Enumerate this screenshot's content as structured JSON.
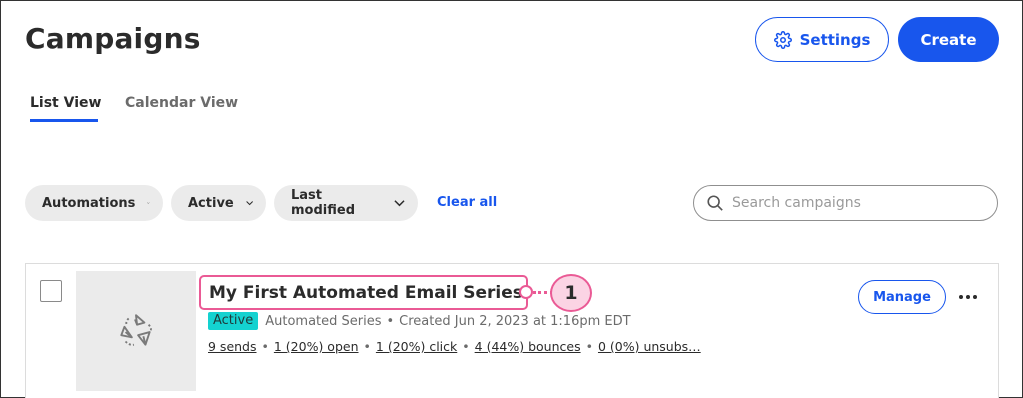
{
  "header": {
    "title": "Campaigns",
    "settings_label": "Settings",
    "create_label": "Create"
  },
  "tabs": [
    {
      "label": "List View",
      "active": true
    },
    {
      "label": "Calendar View",
      "active": false
    }
  ],
  "filters": {
    "items": [
      {
        "label": "Automations"
      },
      {
        "label": "Active"
      },
      {
        "label": "Last modified"
      }
    ],
    "clear_all_label": "Clear all"
  },
  "search": {
    "placeholder": "Search campaigns",
    "value": ""
  },
  "campaign": {
    "title": "My First Automated Email Series",
    "status": "Active",
    "type": "Automated Series",
    "meta_sep": "•",
    "created": "Created Jun 2, 2023 at 1:16pm EDT",
    "stats": [
      "9 sends",
      "1 (20%) open",
      "1 (20%) click",
      "4 (44%) bounces",
      "0 (0%) unsubs…"
    ],
    "manage_label": "Manage",
    "callout_number": "1"
  },
  "colors": {
    "accent": "#1856ed",
    "callout": "#ea5a95",
    "callout_fill": "#fbd4e4",
    "active_badge": "#14d2d0",
    "chip_bg": "#ebebeb"
  },
  "icons": {
    "settings": "gear-icon",
    "chevron": "chevron-down-icon",
    "search": "search-icon",
    "thumbnail": "paper-plane-icon",
    "more": "more-horizontal-icon"
  }
}
